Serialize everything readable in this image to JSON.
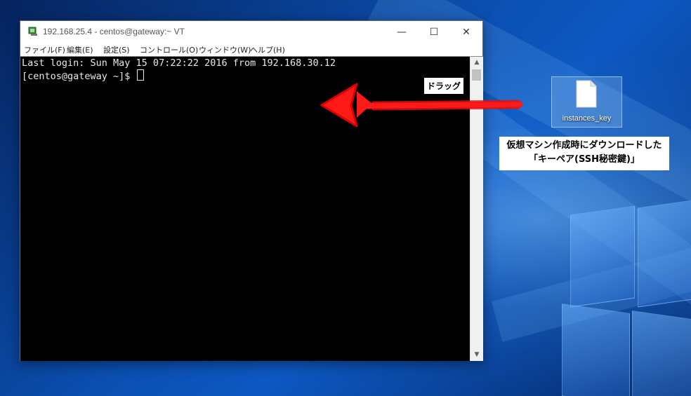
{
  "window": {
    "title": "192.168.25.4 - centos@gateway:~ VT",
    "controls": {
      "minimize": "—",
      "maximize": "☐",
      "close": "✕"
    },
    "menu": [
      "ファイル(F)",
      "編集(E)",
      "設定(S)",
      "コントロール(O)",
      "ウィンドウ(W)",
      "ヘルプ(H)"
    ]
  },
  "terminal": {
    "lines": [
      "Last login: Sun May 15 07:22:22 2016 from 192.168.30.12",
      "[centos@gateway ~]$ "
    ]
  },
  "annotation": {
    "drag_label": "ドラッグ",
    "arrow_color": "#ff1a1a",
    "caption_line1": "仮想マシン作成時にダウンロードした",
    "caption_line2": "「キーペア(SSH秘密鍵)」"
  },
  "desktop": {
    "file_icon": {
      "icon": "file-icon",
      "label": "instances_key"
    }
  }
}
